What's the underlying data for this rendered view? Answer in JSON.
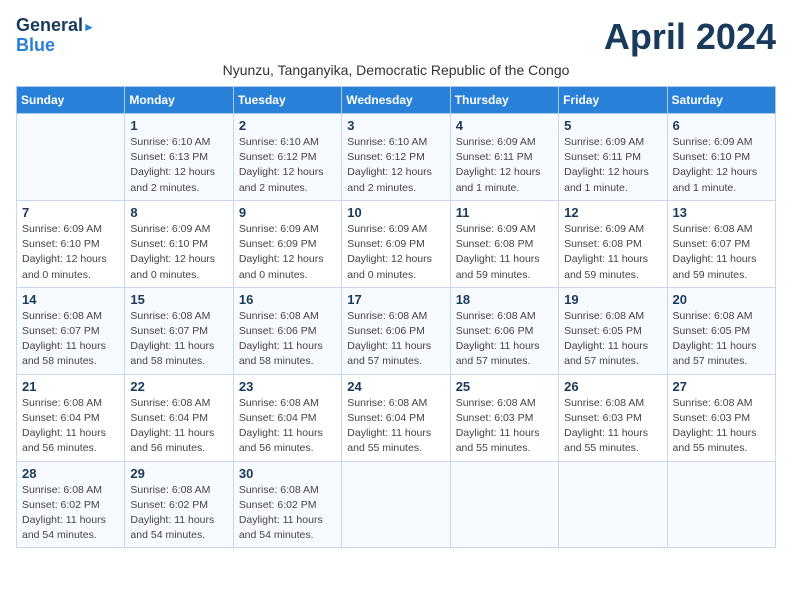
{
  "header": {
    "logo_line1": "General",
    "logo_line2": "Blue",
    "month_title": "April 2024",
    "subtitle": "Nyunzu, Tanganyika, Democratic Republic of the Congo"
  },
  "columns": [
    "Sunday",
    "Monday",
    "Tuesday",
    "Wednesday",
    "Thursday",
    "Friday",
    "Saturday"
  ],
  "weeks": [
    [
      {
        "day": "",
        "sunrise": "",
        "sunset": "",
        "daylight": ""
      },
      {
        "day": "1",
        "sunrise": "Sunrise: 6:10 AM",
        "sunset": "Sunset: 6:13 PM",
        "daylight": "Daylight: 12 hours and 2 minutes."
      },
      {
        "day": "2",
        "sunrise": "Sunrise: 6:10 AM",
        "sunset": "Sunset: 6:12 PM",
        "daylight": "Daylight: 12 hours and 2 minutes."
      },
      {
        "day": "3",
        "sunrise": "Sunrise: 6:10 AM",
        "sunset": "Sunset: 6:12 PM",
        "daylight": "Daylight: 12 hours and 2 minutes."
      },
      {
        "day": "4",
        "sunrise": "Sunrise: 6:09 AM",
        "sunset": "Sunset: 6:11 PM",
        "daylight": "Daylight: 12 hours and 1 minute."
      },
      {
        "day": "5",
        "sunrise": "Sunrise: 6:09 AM",
        "sunset": "Sunset: 6:11 PM",
        "daylight": "Daylight: 12 hours and 1 minute."
      },
      {
        "day": "6",
        "sunrise": "Sunrise: 6:09 AM",
        "sunset": "Sunset: 6:10 PM",
        "daylight": "Daylight: 12 hours and 1 minute."
      }
    ],
    [
      {
        "day": "7",
        "sunrise": "Sunrise: 6:09 AM",
        "sunset": "Sunset: 6:10 PM",
        "daylight": "Daylight: 12 hours and 0 minutes."
      },
      {
        "day": "8",
        "sunrise": "Sunrise: 6:09 AM",
        "sunset": "Sunset: 6:10 PM",
        "daylight": "Daylight: 12 hours and 0 minutes."
      },
      {
        "day": "9",
        "sunrise": "Sunrise: 6:09 AM",
        "sunset": "Sunset: 6:09 PM",
        "daylight": "Daylight: 12 hours and 0 minutes."
      },
      {
        "day": "10",
        "sunrise": "Sunrise: 6:09 AM",
        "sunset": "Sunset: 6:09 PM",
        "daylight": "Daylight: 12 hours and 0 minutes."
      },
      {
        "day": "11",
        "sunrise": "Sunrise: 6:09 AM",
        "sunset": "Sunset: 6:08 PM",
        "daylight": "Daylight: 11 hours and 59 minutes."
      },
      {
        "day": "12",
        "sunrise": "Sunrise: 6:09 AM",
        "sunset": "Sunset: 6:08 PM",
        "daylight": "Daylight: 11 hours and 59 minutes."
      },
      {
        "day": "13",
        "sunrise": "Sunrise: 6:08 AM",
        "sunset": "Sunset: 6:07 PM",
        "daylight": "Daylight: 11 hours and 59 minutes."
      }
    ],
    [
      {
        "day": "14",
        "sunrise": "Sunrise: 6:08 AM",
        "sunset": "Sunset: 6:07 PM",
        "daylight": "Daylight: 11 hours and 58 minutes."
      },
      {
        "day": "15",
        "sunrise": "Sunrise: 6:08 AM",
        "sunset": "Sunset: 6:07 PM",
        "daylight": "Daylight: 11 hours and 58 minutes."
      },
      {
        "day": "16",
        "sunrise": "Sunrise: 6:08 AM",
        "sunset": "Sunset: 6:06 PM",
        "daylight": "Daylight: 11 hours and 58 minutes."
      },
      {
        "day": "17",
        "sunrise": "Sunrise: 6:08 AM",
        "sunset": "Sunset: 6:06 PM",
        "daylight": "Daylight: 11 hours and 57 minutes."
      },
      {
        "day": "18",
        "sunrise": "Sunrise: 6:08 AM",
        "sunset": "Sunset: 6:06 PM",
        "daylight": "Daylight: 11 hours and 57 minutes."
      },
      {
        "day": "19",
        "sunrise": "Sunrise: 6:08 AM",
        "sunset": "Sunset: 6:05 PM",
        "daylight": "Daylight: 11 hours and 57 minutes."
      },
      {
        "day": "20",
        "sunrise": "Sunrise: 6:08 AM",
        "sunset": "Sunset: 6:05 PM",
        "daylight": "Daylight: 11 hours and 57 minutes."
      }
    ],
    [
      {
        "day": "21",
        "sunrise": "Sunrise: 6:08 AM",
        "sunset": "Sunset: 6:04 PM",
        "daylight": "Daylight: 11 hours and 56 minutes."
      },
      {
        "day": "22",
        "sunrise": "Sunrise: 6:08 AM",
        "sunset": "Sunset: 6:04 PM",
        "daylight": "Daylight: 11 hours and 56 minutes."
      },
      {
        "day": "23",
        "sunrise": "Sunrise: 6:08 AM",
        "sunset": "Sunset: 6:04 PM",
        "daylight": "Daylight: 11 hours and 56 minutes."
      },
      {
        "day": "24",
        "sunrise": "Sunrise: 6:08 AM",
        "sunset": "Sunset: 6:04 PM",
        "daylight": "Daylight: 11 hours and 55 minutes."
      },
      {
        "day": "25",
        "sunrise": "Sunrise: 6:08 AM",
        "sunset": "Sunset: 6:03 PM",
        "daylight": "Daylight: 11 hours and 55 minutes."
      },
      {
        "day": "26",
        "sunrise": "Sunrise: 6:08 AM",
        "sunset": "Sunset: 6:03 PM",
        "daylight": "Daylight: 11 hours and 55 minutes."
      },
      {
        "day": "27",
        "sunrise": "Sunrise: 6:08 AM",
        "sunset": "Sunset: 6:03 PM",
        "daylight": "Daylight: 11 hours and 55 minutes."
      }
    ],
    [
      {
        "day": "28",
        "sunrise": "Sunrise: 6:08 AM",
        "sunset": "Sunset: 6:02 PM",
        "daylight": "Daylight: 11 hours and 54 minutes."
      },
      {
        "day": "29",
        "sunrise": "Sunrise: 6:08 AM",
        "sunset": "Sunset: 6:02 PM",
        "daylight": "Daylight: 11 hours and 54 minutes."
      },
      {
        "day": "30",
        "sunrise": "Sunrise: 6:08 AM",
        "sunset": "Sunset: 6:02 PM",
        "daylight": "Daylight: 11 hours and 54 minutes."
      },
      {
        "day": "",
        "sunrise": "",
        "sunset": "",
        "daylight": ""
      },
      {
        "day": "",
        "sunrise": "",
        "sunset": "",
        "daylight": ""
      },
      {
        "day": "",
        "sunrise": "",
        "sunset": "",
        "daylight": ""
      },
      {
        "day": "",
        "sunrise": "",
        "sunset": "",
        "daylight": ""
      }
    ]
  ]
}
